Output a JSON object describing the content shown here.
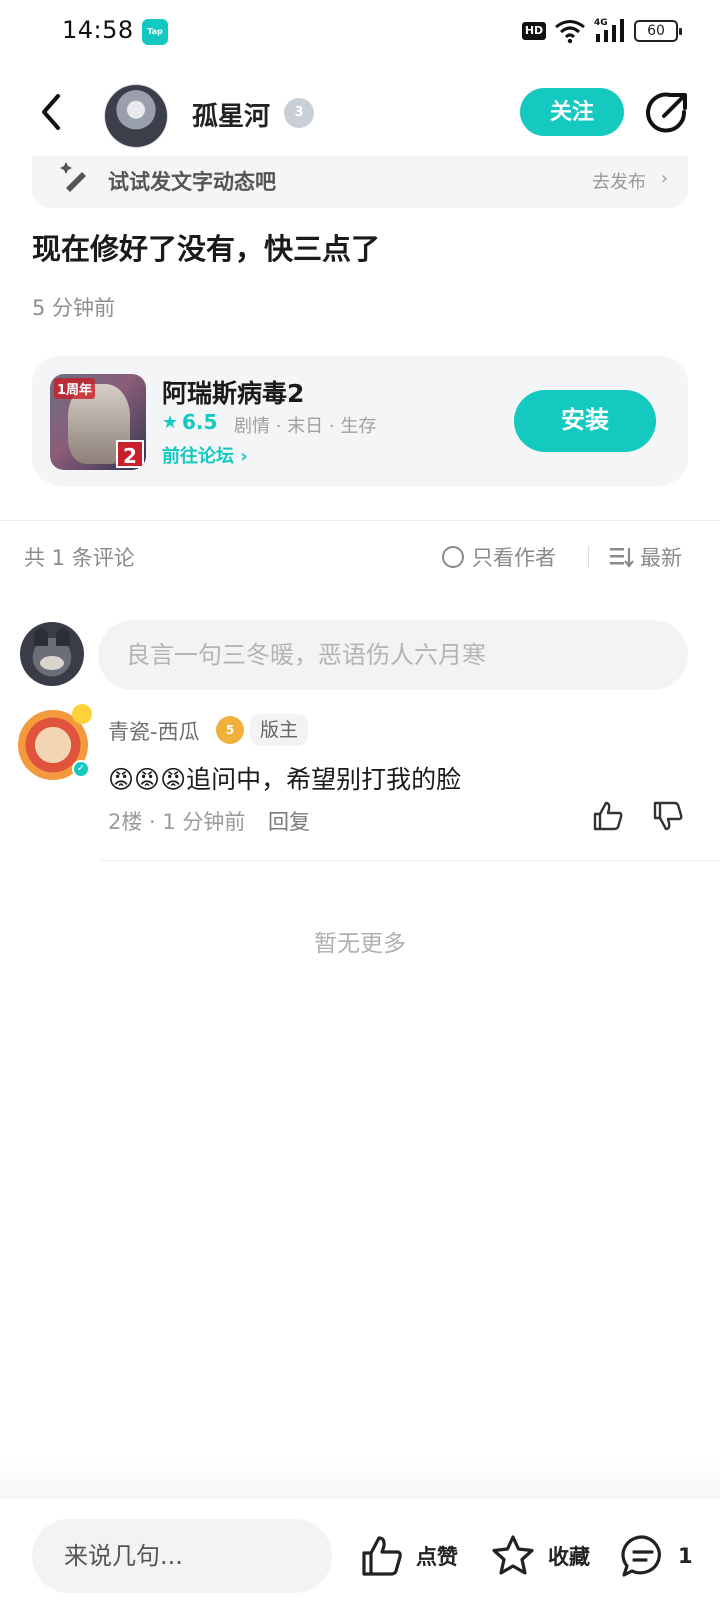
{
  "status_bar": {
    "time": "14:58",
    "app_badge": "Tap",
    "hd": "HD",
    "network": "4G",
    "battery": "60"
  },
  "header": {
    "username": "孤星河",
    "level": "3",
    "follow_label": "关注"
  },
  "tip": {
    "text": "试试发文字动态吧",
    "action": "去发布"
  },
  "post": {
    "text": "现在修好了没有，快三点了",
    "time": "5 分钟前"
  },
  "game": {
    "icon_anniversary": "1周年",
    "icon_number": "2",
    "title": "阿瑞斯病毒2",
    "rating": "6.5",
    "tags": "剧情 · 末日 · 生存",
    "forum_link": "前往论坛",
    "install_label": "安装"
  },
  "comments_bar": {
    "count": "共 1 条评论",
    "author_only": "只看作者",
    "sort": "最新"
  },
  "comment_input": {
    "placeholder": "良言一句三冬暖，恶语伤人六月寒"
  },
  "comments": [
    {
      "author": "青瓷-西瓜",
      "level": "5",
      "badge": "版主",
      "body": "😡😡😡追问中，希望别打我的脸",
      "meta": "2楼 · 1 分钟前",
      "reply": "回复"
    }
  ],
  "footer_note": "暂无更多",
  "bottom_bar": {
    "input_placeholder": "来说几句...",
    "like_label": "点赞",
    "favorite_label": "收藏",
    "comment_count": "1"
  },
  "colors": {
    "accent": "#14c9bf",
    "text_primary": "#1a1a1a",
    "text_secondary": "#8a8a8a"
  }
}
